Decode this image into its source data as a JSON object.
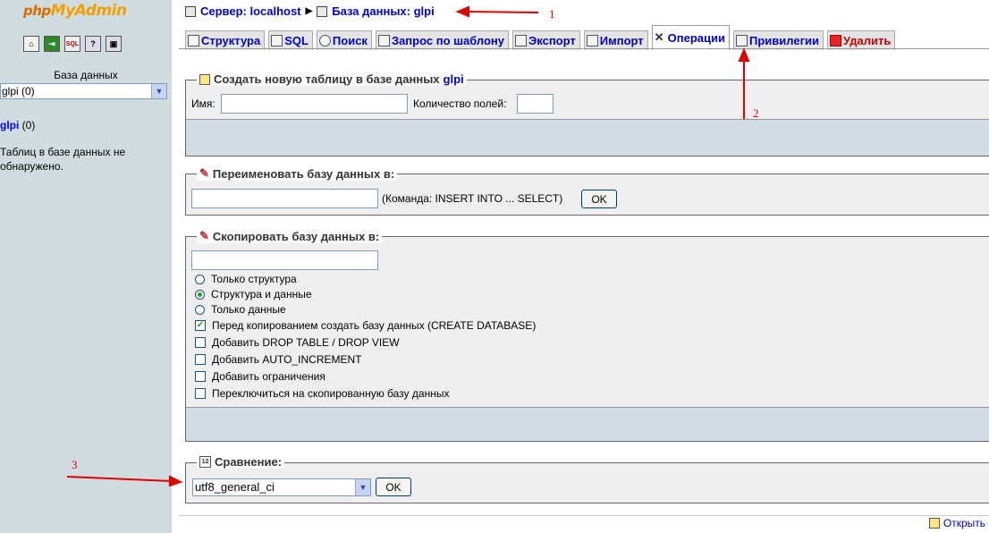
{
  "left_panel": {
    "logo_part1": "php",
    "logo_part2": "MyAdmin",
    "quick_icons": [
      "home-icon",
      "exit-icon",
      "sql-icon",
      "docs-icon",
      "query-icon"
    ],
    "db_label": "База данных",
    "db_select": "glpi (0)",
    "db_link": "glpi",
    "db_count": "(0)",
    "no_tables": "Таблиц в базе данных не обнаружено."
  },
  "breadcrumb": {
    "server": "Сервер: localhost",
    "database": "База данных: glpi"
  },
  "tabs": [
    {
      "label": "Структура",
      "icon": "structure-icon"
    },
    {
      "label": "SQL",
      "icon": "sql-icon"
    },
    {
      "label": "Поиск",
      "icon": "search-icon"
    },
    {
      "label": "Запрос по шаблону",
      "icon": "query-icon"
    },
    {
      "label": "Экспорт",
      "icon": "export-icon"
    },
    {
      "label": "Импорт",
      "icon": "import-icon"
    },
    {
      "label": "Операции",
      "icon": "operations-icon",
      "active": true
    },
    {
      "label": "Привилегии",
      "icon": "privileges-icon"
    },
    {
      "label": "Удалить",
      "icon": "drop-icon"
    }
  ],
  "create_table": {
    "legend_prefix": "Создать новую таблицу в базе данных",
    "legend_db": "glpi",
    "name_label": "Имя:",
    "fields_label": "Количество полей:",
    "name_value": "",
    "fields_value": ""
  },
  "rename": {
    "legend": "Переименовать базу данных в:",
    "value": "",
    "hint": "(Команда: INSERT INTO ... SELECT)",
    "ok": "OK"
  },
  "copy": {
    "legend": "Скопировать базу данных в:",
    "value": "",
    "radios": [
      {
        "label": "Только структура",
        "checked": false
      },
      {
        "label": "Структура и данные",
        "checked": true
      },
      {
        "label": "Только данные",
        "checked": false
      }
    ],
    "checkboxes": [
      {
        "label": "Перед копированием создать базу данных (CREATE DATABASE)",
        "checked": true
      },
      {
        "label": "Добавить DROP TABLE / DROP VIEW",
        "checked": false
      },
      {
        "label": "Добавить AUTO_INCREMENT",
        "checked": false
      },
      {
        "label": "Добавить ограничения",
        "checked": false
      },
      {
        "label": "Переключиться на скопированную базу данных",
        "checked": false
      }
    ]
  },
  "collation": {
    "legend": "Сравнение:",
    "selected": "utf8_general_ci",
    "ok": "OK"
  },
  "footer": {
    "open_link": "Открыть"
  },
  "annotations": {
    "n1": "1",
    "n2": "2",
    "n3": "3",
    "color": "#e00000"
  }
}
